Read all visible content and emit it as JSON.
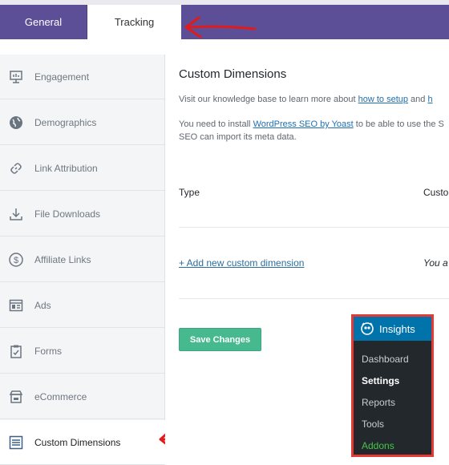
{
  "tabs": {
    "general": "General",
    "tracking": "Tracking"
  },
  "sidebar": {
    "items": [
      {
        "label": "Engagement",
        "icon": "presentation-icon"
      },
      {
        "label": "Demographics",
        "icon": "globe-icon"
      },
      {
        "label": "Link Attribution",
        "icon": "link-icon"
      },
      {
        "label": "File Downloads",
        "icon": "download-icon"
      },
      {
        "label": "Affiliate Links",
        "icon": "dollar-icon"
      },
      {
        "label": "Ads",
        "icon": "ads-layout-icon"
      },
      {
        "label": "Forms",
        "icon": "clipboard-icon"
      },
      {
        "label": "eCommerce",
        "icon": "store-icon"
      },
      {
        "label": "Custom Dimensions",
        "icon": "dimensions-icon"
      }
    ]
  },
  "main": {
    "title": "Custom Dimensions",
    "kb_prefix": "Visit our knowledge base to learn more about ",
    "kb_link1": "how to setup",
    "kb_and": " and ",
    "kb_link2": "h",
    "install_prefix": "You need to install ",
    "install_link": "WordPress SEO by Yoast",
    "install_suffix": " to be able to use the S",
    "install_line2": "SEO can import its meta data.",
    "col_type": "Type",
    "col_custom": "Custo",
    "add_link": "+ Add new custom dimension",
    "you_a": "You a",
    "save_button": "Save Changes"
  },
  "wp_menu": {
    "title": "Insights",
    "items": [
      "Dashboard",
      "Settings",
      "Reports",
      "Tools",
      "Addons"
    ]
  },
  "colors": {
    "header_purple": "#5c4f98",
    "save_green": "#46b98f",
    "wp_blue": "#0073aa",
    "annotation_red": "#e53935",
    "addons_green": "#48c34b"
  }
}
